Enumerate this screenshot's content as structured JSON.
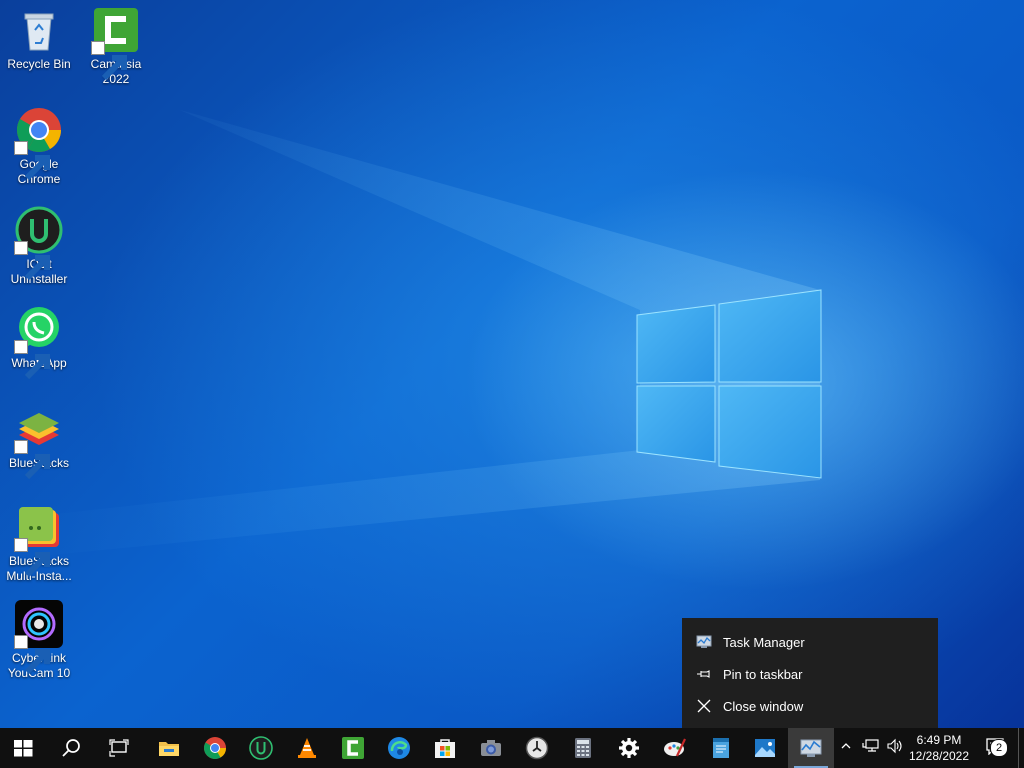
{
  "desktop": {
    "icons": [
      {
        "label": "Recycle Bin",
        "icon": "recycle-bin-icon"
      },
      {
        "label": "Camtasia 2022",
        "icon": "camtasia-icon"
      },
      {
        "label": "Google Chrome",
        "icon": "chrome-icon"
      },
      {
        "label": "IObit Uninstaller",
        "icon": "iobit-uninstaller-icon"
      },
      {
        "label": "WhatsApp",
        "icon": "whatsapp-icon"
      },
      {
        "label": "BlueStacks",
        "icon": "bluestacks-icon"
      },
      {
        "label": "BlueStacks Multi-Insta...",
        "icon": "bluestacks-multi-instance-icon"
      },
      {
        "label": "CyberLink YouCam 10",
        "icon": "youcam-icon"
      }
    ]
  },
  "jumplist": {
    "items": [
      {
        "label": "Task Manager",
        "icon": "task-manager-icon"
      },
      {
        "label": "Pin to taskbar",
        "icon": "pin-icon"
      },
      {
        "label": "Close window",
        "icon": "close-icon"
      }
    ]
  },
  "taskbar": {
    "buttons": [
      "start-icon",
      "search-icon",
      "task-view-icon",
      "file-explorer-icon",
      "chrome-icon",
      "iobit-uninstaller-icon",
      "vlc-icon",
      "camtasia-icon",
      "edge-icon",
      "microsoft-store-icon",
      "camera-icon",
      "clock-app-icon",
      "calculator-icon",
      "settings-icon",
      "paint-icon",
      "notepad-icon",
      "photos-icon",
      "task-manager-icon"
    ],
    "tray": [
      "chevron-up-icon",
      "network-icon",
      "volume-icon"
    ],
    "clock": {
      "time": "6:49 PM",
      "date": "12/28/2022"
    },
    "notifications": {
      "count": "2",
      "icon": "action-center-icon"
    }
  },
  "colors": {
    "taskbar": "#101010",
    "menu": "#1f1f1f",
    "wallpaper_accent": "#0b63cf"
  }
}
